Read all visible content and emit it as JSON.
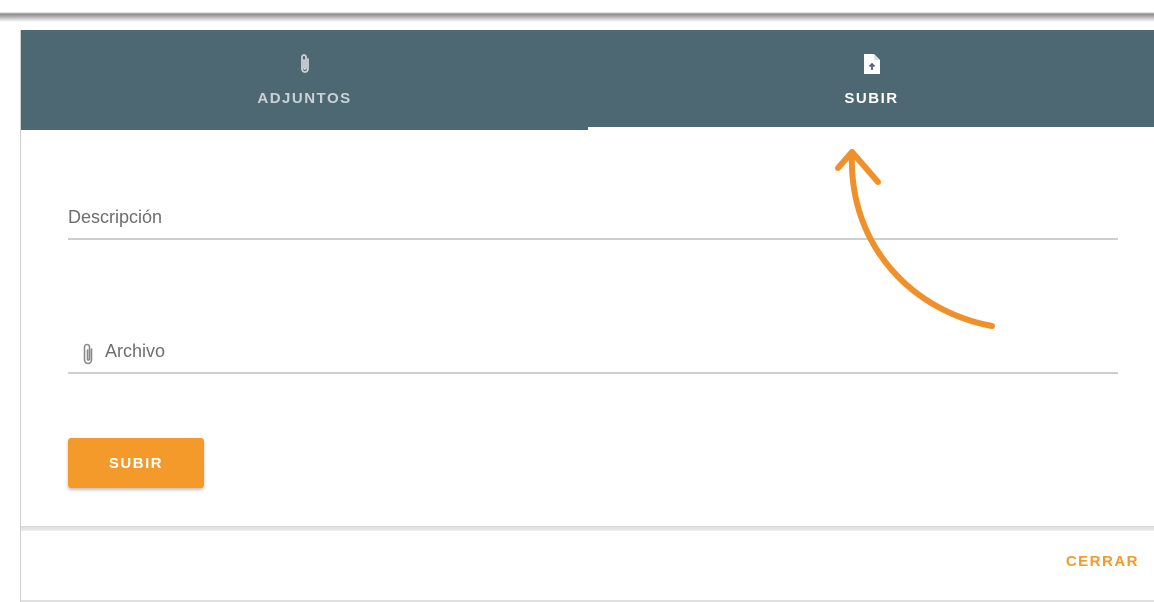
{
  "tabs": [
    {
      "label": "ADJUNTOS",
      "icon": "paperclip-icon",
      "active": false
    },
    {
      "label": "SUBIR",
      "icon": "upload-file-icon",
      "active": true
    }
  ],
  "form": {
    "description_placeholder": "Descripción",
    "file_placeholder": "Archivo",
    "file_icon": "paperclip-icon",
    "upload_label": "SUBIR"
  },
  "footer": {
    "close_label": "CERRAR"
  },
  "colors": {
    "tabbar": "#4e6873",
    "accent": "#f39a2b",
    "annotation": "#f0902a"
  }
}
